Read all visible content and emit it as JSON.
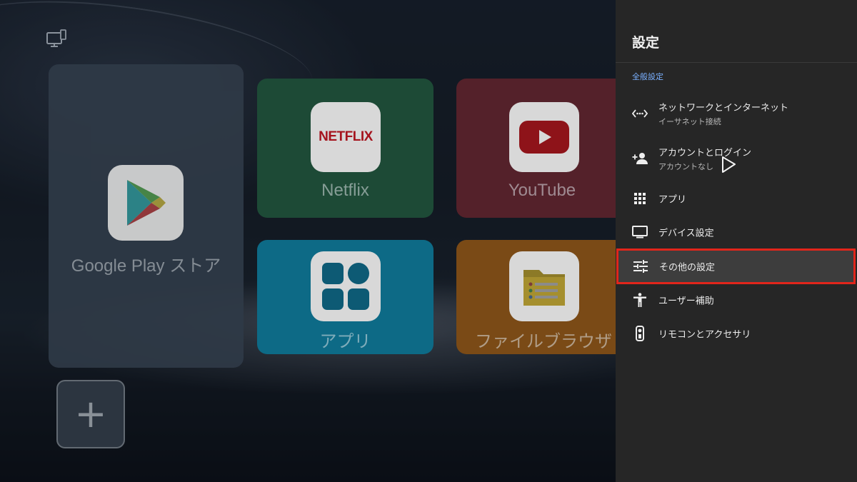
{
  "home": {
    "tiles": {
      "google_play": "Google Play ストア",
      "netflix": "Netflix",
      "netflix_logo": "NETFLIX",
      "youtube": "YouTube",
      "apps": "アプリ",
      "file_browser": "ファイルブラウザ"
    },
    "add_label": "+"
  },
  "settings": {
    "title": "設定",
    "section": "全般設定",
    "items": [
      {
        "label": "ネットワークとインターネット",
        "sub": "イーサネット接続",
        "icon": "network-icon"
      },
      {
        "label": "アカウントとログイン",
        "sub": "アカウントなし",
        "icon": "add-account-icon"
      },
      {
        "label": "アプリ",
        "icon": "apps-grid-icon"
      },
      {
        "label": "デバイス設定",
        "icon": "tv-icon"
      },
      {
        "label": "その他の設定",
        "icon": "sliders-icon",
        "selected": true
      },
      {
        "label": "ユーザー補助",
        "icon": "accessibility-icon"
      },
      {
        "label": "リモコンとアクセサリ",
        "icon": "remote-icon"
      }
    ],
    "highlight_color": "#e1251b",
    "section_color": "#7ab0ff"
  }
}
